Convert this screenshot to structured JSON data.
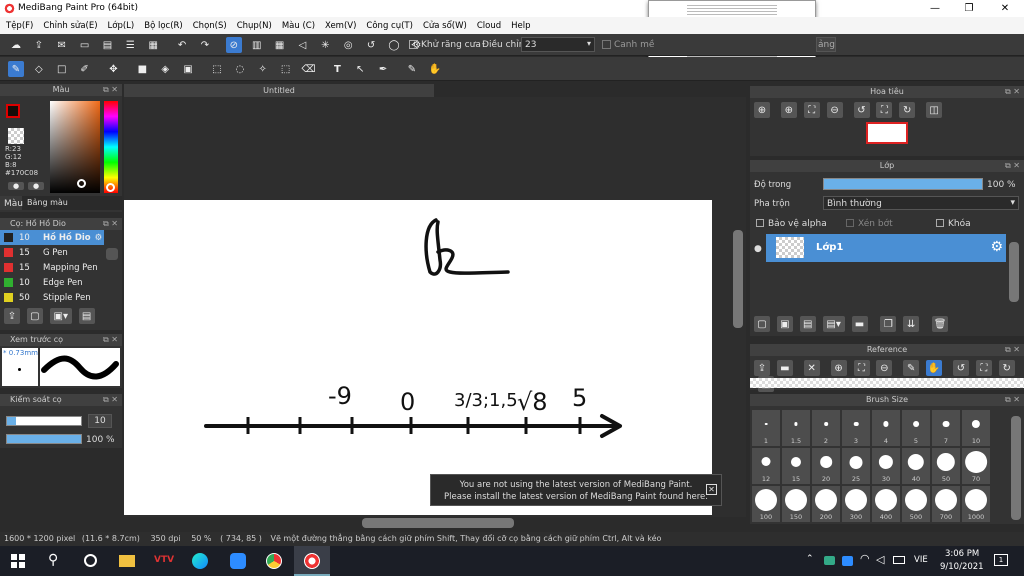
{
  "app": {
    "title": "MediBang Paint Pro (64bit)"
  },
  "menu": [
    "Tệp(F)",
    "Chỉnh sửa(E)",
    "Lớp(L)",
    "Bộ lọc(R)",
    "Chọn(S)",
    "Chụp(N)",
    "Màu (C)",
    "Xem(V)",
    "Công cụ(T)",
    "Cửa sổ(W)",
    "Cloud",
    "Help"
  ],
  "toolbar": {
    "antialias_label": "Khử răng cưa",
    "adjust_label": "Điều chỉnh",
    "adjust_value": "23",
    "canh_label": "Canh mề",
    "right_tag": "ảng"
  },
  "canvas": {
    "tab_title": "Untitled"
  },
  "color_panel": {
    "title": "Màu",
    "r": "R:23",
    "g": "G:12",
    "b": "B:8",
    "hex": "#170C08",
    "tab_color": "Màu",
    "tab_palette": "Bảng màu"
  },
  "brush_panel": {
    "title": "Cọ: Hồ Hồ Dio",
    "brushes": [
      {
        "size": "10",
        "name": "Hồ Hồ Dio",
        "color": "#222222"
      },
      {
        "size": "15",
        "name": "G Pen",
        "color": "#e03030"
      },
      {
        "size": "15",
        "name": "Mapping Pen",
        "color": "#e03030"
      },
      {
        "size": "10",
        "name": "Edge Pen",
        "color": "#30b030"
      },
      {
        "size": "50",
        "name": "Stipple Pen",
        "color": "#e0d020"
      }
    ]
  },
  "preview_panel": {
    "title": "Xem trước cọ",
    "size": "0.73mm"
  },
  "control_panel": {
    "title": "Kiểm soát cọ",
    "size_value": "10",
    "opacity_value": "100 %"
  },
  "navigator": {
    "title": "Hoa tiêu"
  },
  "layer_panel": {
    "title": "Lớp",
    "opacity_label": "Độ trong",
    "opacity_value": "100 %",
    "blend_label": "Pha trộn",
    "blend_value": "Bình thường",
    "protect_alpha": "Bảo vệ alpha",
    "clip": "Xén bớt",
    "lock": "Khóa",
    "layer_name": "Lớp1"
  },
  "reference": {
    "title": "Reference"
  },
  "brush_size": {
    "title": "Brush Size",
    "sizes": [
      "1",
      "1.5",
      "2",
      "3",
      "4",
      "5",
      "7",
      "10",
      "12",
      "15",
      "20",
      "25",
      "30",
      "40",
      "50",
      "70",
      "100",
      "150",
      "200",
      "300",
      "400",
      "500",
      "700",
      "1000"
    ]
  },
  "notice": {
    "line1": "You are not using the latest version of MediBang Paint.",
    "line2": "Please install the latest version of MediBang Paint found here."
  },
  "status": {
    "dims": "1600 * 1200 pixel",
    "cm": "(11.6 * 8.7cm)",
    "dpi": "350 dpi",
    "zoom": "50 %",
    "coords": "( 734, 85 )",
    "hint": "Vẽ một đường thẳng bằng cách giữ phím Shift, Thay đổi cỡ cọ bằng cách giữ phím Ctrl, Alt và kéo"
  },
  "taskbar": {
    "lang": "VIE",
    "time": "3:06 PM",
    "date": "9/10/2021",
    "notif": "1"
  },
  "drawing": {
    "labels": [
      "-9",
      "0",
      "3/3;1,5",
      "√8",
      "5"
    ]
  }
}
